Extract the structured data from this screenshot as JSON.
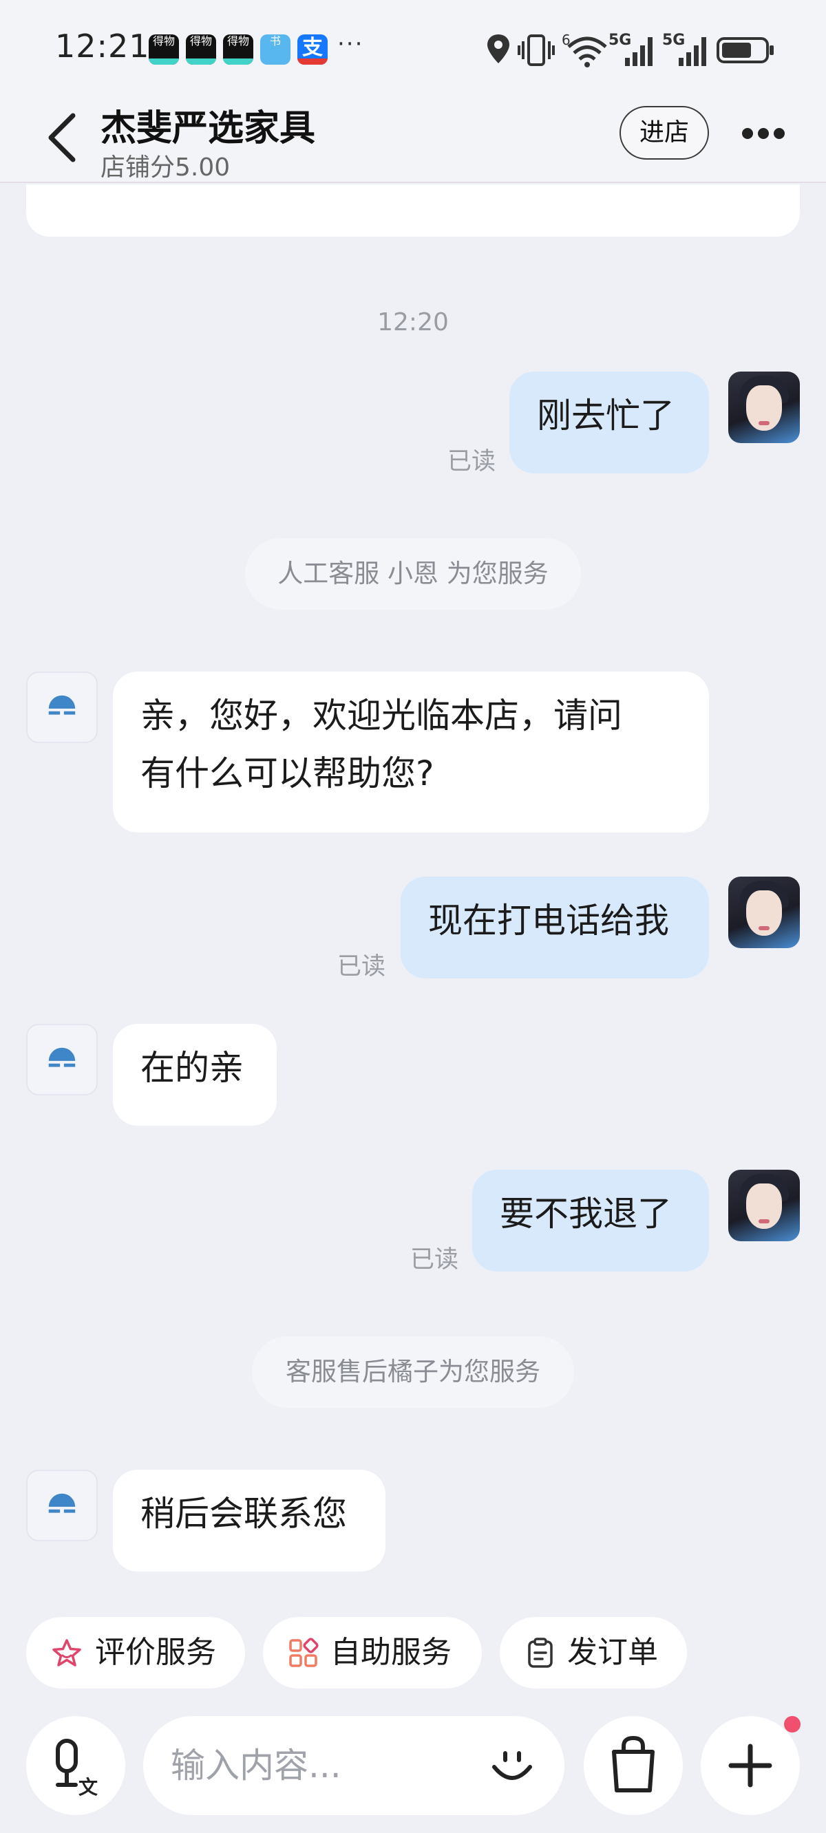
{
  "status_bar": {
    "time": "12:21",
    "app_icons": [
      "得物",
      "得物",
      "得物",
      "书",
      "支"
    ],
    "more": "···",
    "network_1": "5G",
    "network_2": "5G",
    "wifi_badge": "6"
  },
  "header": {
    "title": "杰斐严选家具",
    "score": "店铺分5.00",
    "enter_shop": "进店"
  },
  "chat": {
    "timestamp": "12:20",
    "messages": [
      {
        "from": "me",
        "text": "刚去忙了",
        "status": "已读"
      },
      {
        "from": "system",
        "text": "人工客服 小恩 为您服务"
      },
      {
        "from": "shop",
        "text_line1": "亲，您好，欢迎光临本店，请问",
        "text_line2": "有什么可以帮助您?"
      },
      {
        "from": "me",
        "text": "现在打电话给我",
        "status": "已读"
      },
      {
        "from": "shop",
        "text": "在的亲"
      },
      {
        "from": "me",
        "text": "要不我退了",
        "status": "已读"
      },
      {
        "from": "system",
        "text": "客服售后橘子为您服务"
      },
      {
        "from": "shop",
        "text": "稍后会联系您"
      }
    ]
  },
  "quick_actions": [
    {
      "label": "评价服务",
      "icon": "star-icon"
    },
    {
      "label": "自助服务",
      "icon": "grid-icon"
    },
    {
      "label": "发订单",
      "icon": "order-icon"
    }
  ],
  "input_bar": {
    "placeholder": "输入内容...",
    "voice_badge": "文"
  },
  "colors": {
    "background": "#eef0f6",
    "my_bubble": "#d8e9fb",
    "their_bubble": "#ffffff",
    "notification_dot": "#f0506e",
    "star_icon": "#e0456b",
    "grid_icon": "#f07b62"
  }
}
